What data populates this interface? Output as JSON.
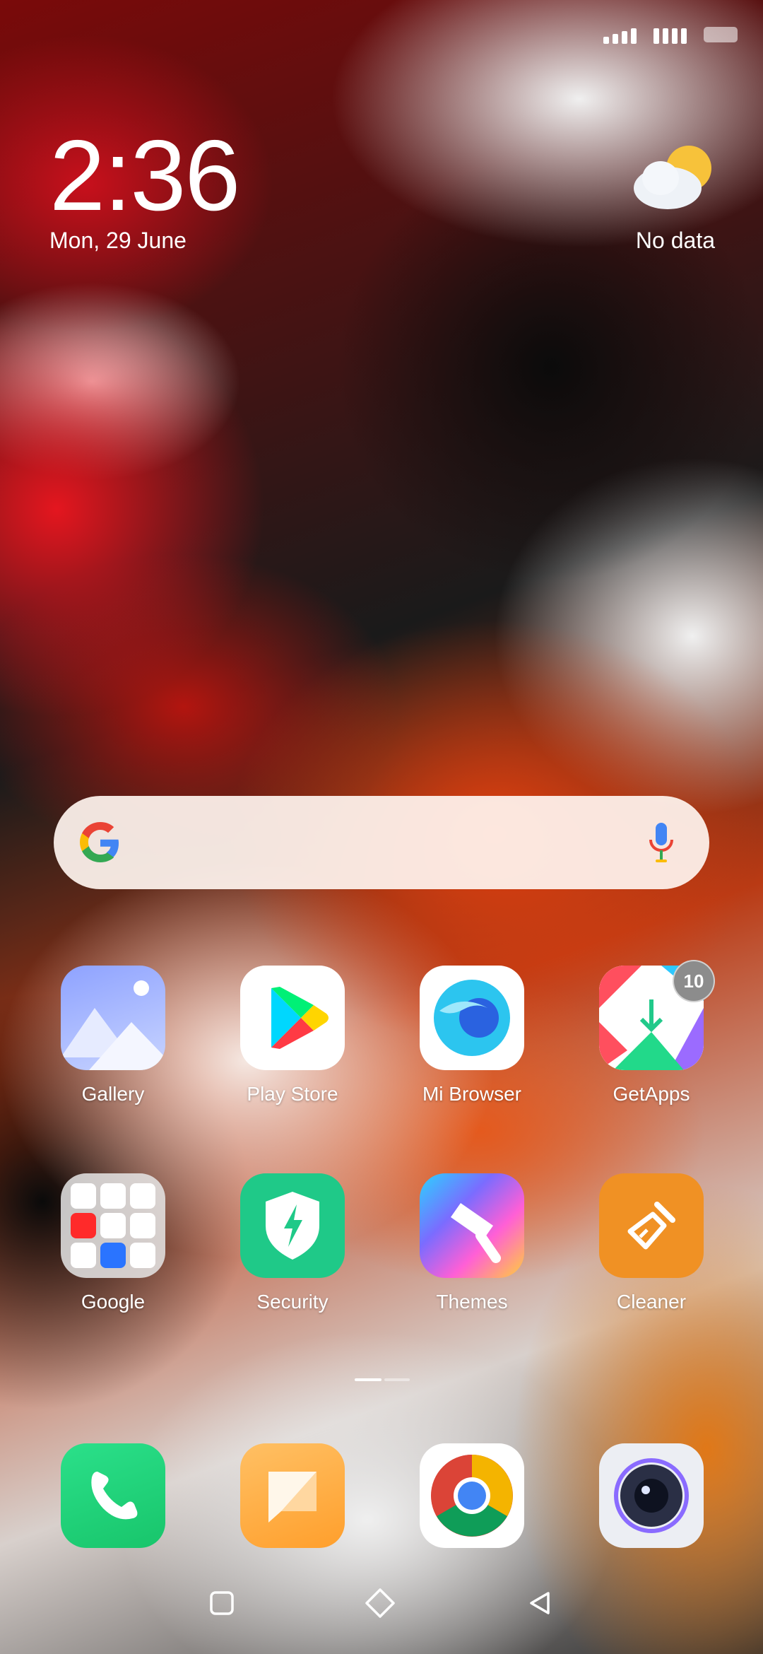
{
  "status_bar": {
    "signal_1_icon": "signal-bars-icon",
    "signal_2_icon": "signal-bars-icon",
    "battery_icon": "battery-icon"
  },
  "clock": {
    "time": "2:36",
    "date": "Mon, 29 June"
  },
  "weather": {
    "icon": "partly-cloudy-icon",
    "text": "No data"
  },
  "search": {
    "logo": "google-g-icon",
    "mic": "mic-icon"
  },
  "apps_row1": [
    {
      "label": "Gallery"
    },
    {
      "label": "Play Store"
    },
    {
      "label": "Mi Browser"
    },
    {
      "label": "GetApps",
      "badge": "10"
    }
  ],
  "apps_row2": [
    {
      "label": "Google"
    },
    {
      "label": "Security"
    },
    {
      "label": "Themes"
    },
    {
      "label": "Cleaner"
    }
  ],
  "dock": [
    {
      "icon": "phone-icon"
    },
    {
      "icon": "messages-icon"
    },
    {
      "icon": "chrome-icon"
    },
    {
      "icon": "camera-icon"
    }
  ],
  "nav": {
    "recents": "recents-icon",
    "home": "home-icon",
    "back": "back-icon"
  },
  "colors": {
    "gallery": "#8f9dfb",
    "security": "#1fc988",
    "cleaner": "#f09124",
    "phone": "#22d77a",
    "messages": "#ffad40"
  }
}
